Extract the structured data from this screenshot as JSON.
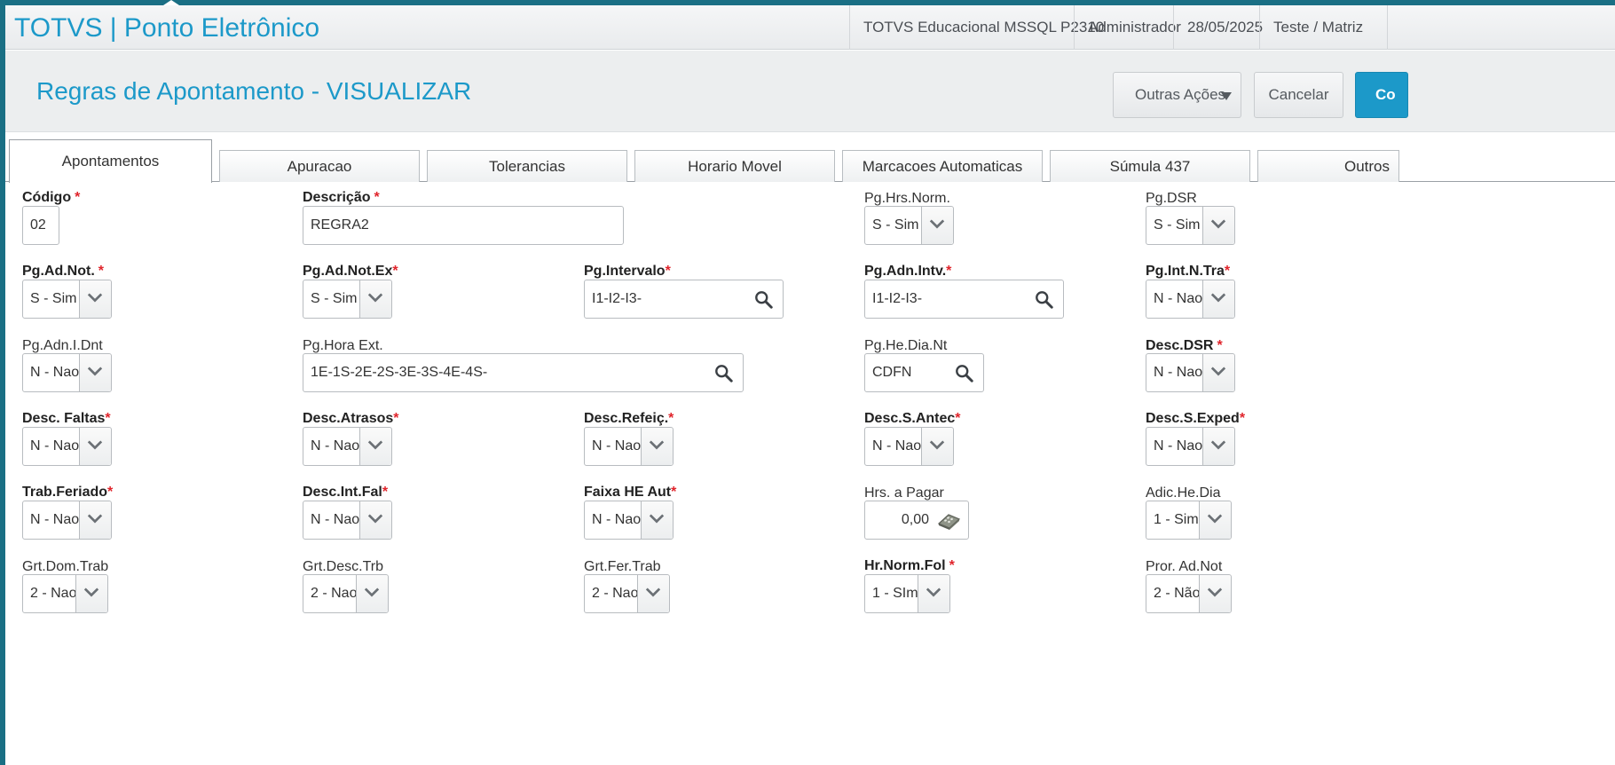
{
  "colors": {
    "accent": "#1c99c9",
    "required": "#e0242b",
    "topbar": "#1a6f84"
  },
  "app_title": "TOTVS | Ponto Eletrônico",
  "header_info": [
    "TOTVS Educacional MSSQL P2310",
    "Administrador",
    "28/05/2025",
    "Teste / Matriz"
  ],
  "page_title": "Regras de Apontamento - VISUALIZAR",
  "actions": {
    "outras": "Outras Ações",
    "cancelar": "Cancelar",
    "confirmar": "Co"
  },
  "tabs": [
    "Apontamentos",
    "Apuracao",
    "Tolerancias",
    "Horario Movel",
    "Marcacoes Automaticas",
    "Súmula 437",
    "Outros"
  ],
  "active_tab": "Apontamentos",
  "fields": {
    "codigo": {
      "label": "Código",
      "value": "02"
    },
    "descricao": {
      "label": "Descrição",
      "value": "REGRA2"
    },
    "pg_hrs_norm": {
      "label": "Pg.Hrs.Norm.",
      "value": "S - Sim"
    },
    "pg_dsr": {
      "label": "Pg.DSR",
      "value": "S - Sim"
    },
    "pg_ad_not": {
      "label": "Pg.Ad.Not.",
      "value": "S - Sim"
    },
    "pg_ad_not_ex": {
      "label": "Pg.Ad.Not.Ex",
      "value": "S - Sim"
    },
    "pg_intervalo": {
      "label": "Pg.Intervalo",
      "value": "I1-I2-I3-"
    },
    "pg_adn_intv": {
      "label": "Pg.Adn.Intv.",
      "value": "I1-I2-I3-"
    },
    "pg_int_n_tra": {
      "label": "Pg.Int.N.Tra",
      "value": "N - Nao"
    },
    "pg_adn_i_dnt": {
      "label": "Pg.Adn.I.Dnt",
      "value": "N - Nao"
    },
    "pg_hora_ext": {
      "label": "Pg.Hora Ext.",
      "value": "1E-1S-2E-2S-3E-3S-4E-4S-"
    },
    "pg_he_dia_nt": {
      "label": "Pg.He.Dia.Nt",
      "value": "CDFN"
    },
    "desc_dsr": {
      "label": "Desc.DSR",
      "value": "N - Nao"
    },
    "desc_faltas": {
      "label": "Desc. Faltas",
      "value": "N - Nao"
    },
    "desc_atrasos": {
      "label": "Desc.Atrasos",
      "value": "N - Nao"
    },
    "desc_refeic": {
      "label": "Desc.Refeiç.",
      "value": "N - Nao"
    },
    "desc_s_antec": {
      "label": "Desc.S.Antec",
      "value": "N - Nao"
    },
    "desc_s_exped": {
      "label": "Desc.S.Exped",
      "value": "N - Nao"
    },
    "trab_feriado": {
      "label": "Trab.Feriado",
      "value": "N - Nao"
    },
    "desc_int_fal": {
      "label": "Desc.Int.Fal",
      "value": "N - Nao"
    },
    "faixa_he_aut": {
      "label": "Faixa HE Aut",
      "value": "N - Nao"
    },
    "hrs_a_pagar": {
      "label": "Hrs. a Pagar",
      "value": "0,00"
    },
    "adic_he_dia": {
      "label": "Adic.He.Dia",
      "value": "1 - Sim"
    },
    "grt_dom_trab": {
      "label": "Grt.Dom.Trab",
      "value": "2 - Nao"
    },
    "grt_desc_trb": {
      "label": "Grt.Desc.Trb",
      "value": "2 - Nao"
    },
    "grt_fer_trab": {
      "label": "Grt.Fer.Trab",
      "value": "2 - Nao"
    },
    "hr_norm_fol": {
      "label": "Hr.Norm.Fol",
      "value": "1 - SIm"
    },
    "pror_ad_not": {
      "label": "Pror. Ad.Not",
      "value": "2 - Não"
    }
  },
  "icons": {
    "lookup": "search-icon",
    "dropdown": "chevron-down-icon",
    "calculator": "calculator-icon",
    "menu": "triangle-down-icon"
  },
  "required_mark": "*"
}
